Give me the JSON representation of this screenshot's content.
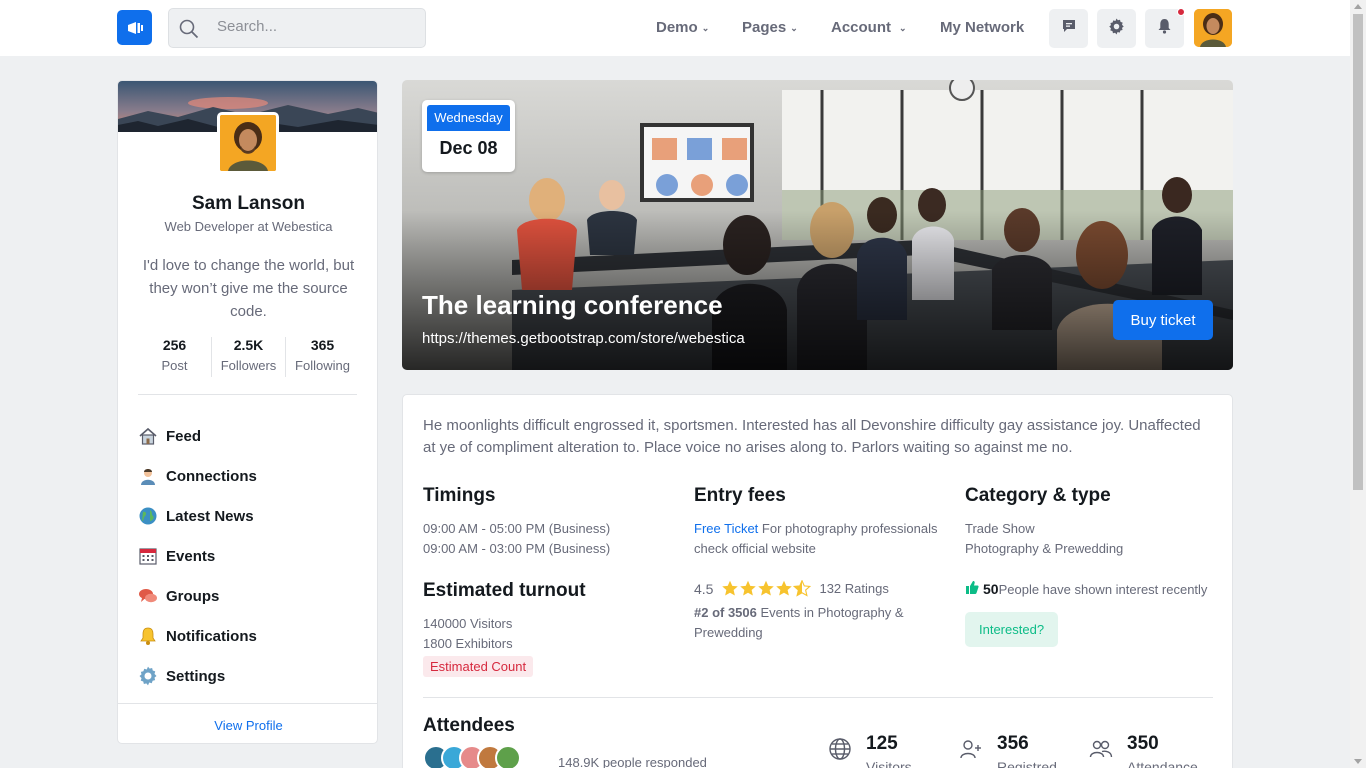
{
  "header": {
    "search_placeholder": "Search...",
    "nav": [
      {
        "label": "Demo",
        "has_dropdown": true
      },
      {
        "label": "Pages",
        "has_dropdown": true
      },
      {
        "label": "Account",
        "has_dropdown": true
      },
      {
        "label": "My Network",
        "has_dropdown": false
      }
    ],
    "icons": [
      "chat-icon",
      "gear-icon",
      "bell-icon"
    ]
  },
  "profile": {
    "name": "Sam Lanson",
    "role": "Web Developer at Webestica",
    "bio": "I'd love to change the world, but they won’t give me the source code.",
    "stats": [
      {
        "value": "256",
        "label": "Post"
      },
      {
        "value": "2.5K",
        "label": "Followers"
      },
      {
        "value": "365",
        "label": "Following"
      }
    ],
    "menu": [
      {
        "label": "Feed",
        "icon": "home-icon"
      },
      {
        "label": "Connections",
        "icon": "person-icon"
      },
      {
        "label": "Latest News",
        "icon": "globe-icon"
      },
      {
        "label": "Events",
        "icon": "calendar-icon"
      },
      {
        "label": "Groups",
        "icon": "chat-bubbles-icon"
      },
      {
        "label": "Notifications",
        "icon": "bell-icon"
      },
      {
        "label": "Settings",
        "icon": "gear-icon"
      }
    ],
    "view_profile": "View Profile"
  },
  "event": {
    "day": "Wednesday",
    "date": "Dec 08",
    "title": "The learning conference",
    "url": "https://themes.getbootstrap.com/store/webestica",
    "buy_label": "Buy ticket",
    "description": "He moonlights difficult engrossed it, sportsmen. Interested has all Devonshire difficulty gay assistance joy. Unaffected at ye of compliment alteration to. Place voice no arises along to. Parlors waiting so against me no.",
    "timings": {
      "title": "Timings",
      "lines": [
        "09:00 AM - 05:00 PM (Business)",
        "09:00 AM - 03:00 PM (Business)"
      ]
    },
    "entry": {
      "title": "Entry fees",
      "link": "Free Ticket",
      "text": " For photography professionals check official website"
    },
    "category": {
      "title": "Category & type",
      "lines": [
        "Trade Show",
        "Photography & Prewedding"
      ]
    },
    "turnout": {
      "title": "Estimated turnout",
      "lines": [
        "140000 Visitors",
        "1800 Exhibitors"
      ],
      "badge": "Estimated Count"
    },
    "rating": {
      "score": "4.5",
      "ratings": "132 Ratings",
      "rank": "#2 of 3506",
      "rank_text": " Events in Photography & Prewedding"
    },
    "interest": {
      "count": "50",
      "text": "People have shown interest recently",
      "button": "Interested?"
    },
    "attendees": {
      "title": "Attendees",
      "responded": "148.9K people responded",
      "metrics": [
        {
          "value": "125",
          "label": "Visitors",
          "icon": "globe-icon"
        },
        {
          "value": "356",
          "label": "Registred",
          "icon": "user-plus-icon"
        },
        {
          "value": "350",
          "label": "Attendance",
          "icon": "people-icon"
        }
      ]
    }
  },
  "colors": {
    "primary": "#0f6fec",
    "danger": "#d6293e",
    "success": "#0cbc87",
    "star": "#f7c32e"
  }
}
